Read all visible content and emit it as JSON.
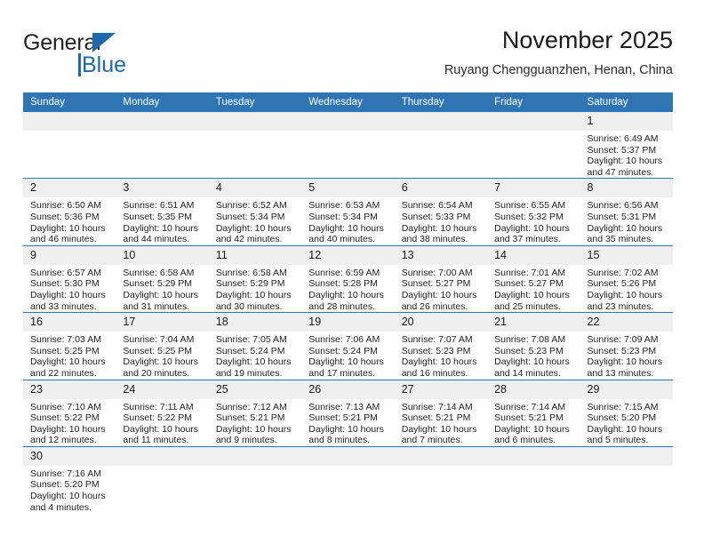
{
  "brand": {
    "name_part1": "General",
    "name_part2": "Blue"
  },
  "header": {
    "title": "November 2025",
    "subtitle": "Ruyang Chengguanzhen, Henan, China"
  },
  "weekdays": [
    "Sunday",
    "Monday",
    "Tuesday",
    "Wednesday",
    "Thursday",
    "Friday",
    "Saturday"
  ],
  "colors": {
    "header_blue": "#2f74b5",
    "brand_blue": "#1d69ab",
    "daynum_band": "#efefef",
    "text": "#222222"
  },
  "labels": {
    "sunrise_prefix": "Sunrise:",
    "sunset_prefix": "Sunset:",
    "daylight_prefix": "Daylight:"
  },
  "weeks": [
    [
      {
        "day": "",
        "empty": true
      },
      {
        "day": "",
        "empty": true
      },
      {
        "day": "",
        "empty": true
      },
      {
        "day": "",
        "empty": true
      },
      {
        "day": "",
        "empty": true
      },
      {
        "day": "",
        "empty": true
      },
      {
        "day": "1",
        "sunrise": "Sunrise: 6:49 AM",
        "sunset": "Sunset: 5:37 PM",
        "daylight": "Daylight: 10 hours and 47 minutes."
      }
    ],
    [
      {
        "day": "2",
        "sunrise": "Sunrise: 6:50 AM",
        "sunset": "Sunset: 5:36 PM",
        "daylight": "Daylight: 10 hours and 46 minutes."
      },
      {
        "day": "3",
        "sunrise": "Sunrise: 6:51 AM",
        "sunset": "Sunset: 5:35 PM",
        "daylight": "Daylight: 10 hours and 44 minutes."
      },
      {
        "day": "4",
        "sunrise": "Sunrise: 6:52 AM",
        "sunset": "Sunset: 5:34 PM",
        "daylight": "Daylight: 10 hours and 42 minutes."
      },
      {
        "day": "5",
        "sunrise": "Sunrise: 6:53 AM",
        "sunset": "Sunset: 5:34 PM",
        "daylight": "Daylight: 10 hours and 40 minutes."
      },
      {
        "day": "6",
        "sunrise": "Sunrise: 6:54 AM",
        "sunset": "Sunset: 5:33 PM",
        "daylight": "Daylight: 10 hours and 38 minutes."
      },
      {
        "day": "7",
        "sunrise": "Sunrise: 6:55 AM",
        "sunset": "Sunset: 5:32 PM",
        "daylight": "Daylight: 10 hours and 37 minutes."
      },
      {
        "day": "8",
        "sunrise": "Sunrise: 6:56 AM",
        "sunset": "Sunset: 5:31 PM",
        "daylight": "Daylight: 10 hours and 35 minutes."
      }
    ],
    [
      {
        "day": "9",
        "sunrise": "Sunrise: 6:57 AM",
        "sunset": "Sunset: 5:30 PM",
        "daylight": "Daylight: 10 hours and 33 minutes."
      },
      {
        "day": "10",
        "sunrise": "Sunrise: 6:58 AM",
        "sunset": "Sunset: 5:29 PM",
        "daylight": "Daylight: 10 hours and 31 minutes."
      },
      {
        "day": "11",
        "sunrise": "Sunrise: 6:58 AM",
        "sunset": "Sunset: 5:29 PM",
        "daylight": "Daylight: 10 hours and 30 minutes."
      },
      {
        "day": "12",
        "sunrise": "Sunrise: 6:59 AM",
        "sunset": "Sunset: 5:28 PM",
        "daylight": "Daylight: 10 hours and 28 minutes."
      },
      {
        "day": "13",
        "sunrise": "Sunrise: 7:00 AM",
        "sunset": "Sunset: 5:27 PM",
        "daylight": "Daylight: 10 hours and 26 minutes."
      },
      {
        "day": "14",
        "sunrise": "Sunrise: 7:01 AM",
        "sunset": "Sunset: 5:27 PM",
        "daylight": "Daylight: 10 hours and 25 minutes."
      },
      {
        "day": "15",
        "sunrise": "Sunrise: 7:02 AM",
        "sunset": "Sunset: 5:26 PM",
        "daylight": "Daylight: 10 hours and 23 minutes."
      }
    ],
    [
      {
        "day": "16",
        "sunrise": "Sunrise: 7:03 AM",
        "sunset": "Sunset: 5:25 PM",
        "daylight": "Daylight: 10 hours and 22 minutes."
      },
      {
        "day": "17",
        "sunrise": "Sunrise: 7:04 AM",
        "sunset": "Sunset: 5:25 PM",
        "daylight": "Daylight: 10 hours and 20 minutes."
      },
      {
        "day": "18",
        "sunrise": "Sunrise: 7:05 AM",
        "sunset": "Sunset: 5:24 PM",
        "daylight": "Daylight: 10 hours and 19 minutes."
      },
      {
        "day": "19",
        "sunrise": "Sunrise: 7:06 AM",
        "sunset": "Sunset: 5:24 PM",
        "daylight": "Daylight: 10 hours and 17 minutes."
      },
      {
        "day": "20",
        "sunrise": "Sunrise: 7:07 AM",
        "sunset": "Sunset: 5:23 PM",
        "daylight": "Daylight: 10 hours and 16 minutes."
      },
      {
        "day": "21",
        "sunrise": "Sunrise: 7:08 AM",
        "sunset": "Sunset: 5:23 PM",
        "daylight": "Daylight: 10 hours and 14 minutes."
      },
      {
        "day": "22",
        "sunrise": "Sunrise: 7:09 AM",
        "sunset": "Sunset: 5:23 PM",
        "daylight": "Daylight: 10 hours and 13 minutes."
      }
    ],
    [
      {
        "day": "23",
        "sunrise": "Sunrise: 7:10 AM",
        "sunset": "Sunset: 5:22 PM",
        "daylight": "Daylight: 10 hours and 12 minutes."
      },
      {
        "day": "24",
        "sunrise": "Sunrise: 7:11 AM",
        "sunset": "Sunset: 5:22 PM",
        "daylight": "Daylight: 10 hours and 11 minutes."
      },
      {
        "day": "25",
        "sunrise": "Sunrise: 7:12 AM",
        "sunset": "Sunset: 5:21 PM",
        "daylight": "Daylight: 10 hours and 9 minutes."
      },
      {
        "day": "26",
        "sunrise": "Sunrise: 7:13 AM",
        "sunset": "Sunset: 5:21 PM",
        "daylight": "Daylight: 10 hours and 8 minutes."
      },
      {
        "day": "27",
        "sunrise": "Sunrise: 7:14 AM",
        "sunset": "Sunset: 5:21 PM",
        "daylight": "Daylight: 10 hours and 7 minutes."
      },
      {
        "day": "28",
        "sunrise": "Sunrise: 7:14 AM",
        "sunset": "Sunset: 5:21 PM",
        "daylight": "Daylight: 10 hours and 6 minutes."
      },
      {
        "day": "29",
        "sunrise": "Sunrise: 7:15 AM",
        "sunset": "Sunset: 5:20 PM",
        "daylight": "Daylight: 10 hours and 5 minutes."
      }
    ],
    [
      {
        "day": "30",
        "sunrise": "Sunrise: 7:16 AM",
        "sunset": "Sunset: 5:20 PM",
        "daylight": "Daylight: 10 hours and 4 minutes."
      },
      {
        "day": "",
        "empty": true
      },
      {
        "day": "",
        "empty": true
      },
      {
        "day": "",
        "empty": true
      },
      {
        "day": "",
        "empty": true
      },
      {
        "day": "",
        "empty": true
      },
      {
        "day": "",
        "empty": true
      }
    ]
  ]
}
